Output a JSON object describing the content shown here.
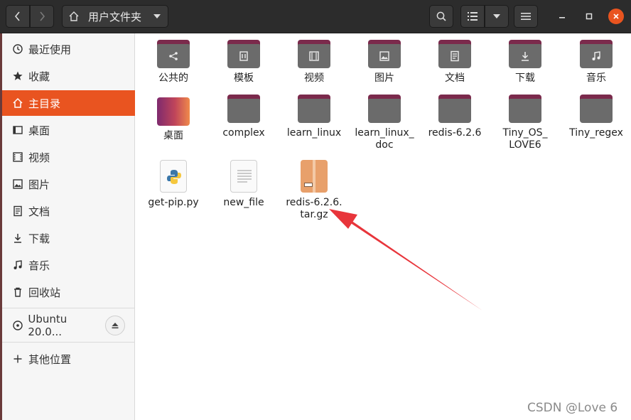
{
  "header": {
    "path_label": "用户文件夹",
    "icons": [
      "chevron-left-icon",
      "chevron-right-icon",
      "home-icon",
      "search-icon",
      "list-view-icon",
      "chevron-down-icon",
      "hamburger-menu-icon",
      "minimize-icon",
      "maximize-icon",
      "close-icon"
    ]
  },
  "sidebar": {
    "items": [
      {
        "label": "最近使用",
        "icon": "clock-icon"
      },
      {
        "label": "收藏",
        "icon": "star-icon"
      },
      {
        "label": "主目录",
        "icon": "home-icon",
        "active": true
      },
      {
        "label": "桌面",
        "icon": "desktop-icon"
      },
      {
        "label": "视频",
        "icon": "video-icon"
      },
      {
        "label": "图片",
        "icon": "image-icon"
      },
      {
        "label": "文档",
        "icon": "document-icon"
      },
      {
        "label": "下载",
        "icon": "download-icon"
      },
      {
        "label": "音乐",
        "icon": "music-icon"
      },
      {
        "label": "回收站",
        "icon": "trash-icon"
      }
    ],
    "drive": {
      "label": "Ubuntu 20.0...",
      "icon": "disc-icon"
    },
    "other": {
      "label": "其他位置",
      "icon": "plus-icon"
    }
  },
  "files": [
    {
      "name": "公共的",
      "kind": "folder",
      "icon": "share-icon"
    },
    {
      "name": "模板",
      "kind": "folder",
      "icon": "template-icon"
    },
    {
      "name": "视频",
      "kind": "folder",
      "icon": "video-icon"
    },
    {
      "name": "图片",
      "kind": "folder",
      "icon": "image-icon"
    },
    {
      "name": "文档",
      "kind": "folder",
      "icon": "document-icon"
    },
    {
      "name": "下载",
      "kind": "folder",
      "icon": "download-icon"
    },
    {
      "name": "音乐",
      "kind": "folder",
      "icon": "music-icon"
    },
    {
      "name": "桌面",
      "kind": "desktop-folder"
    },
    {
      "name": "complex",
      "kind": "folder"
    },
    {
      "name": "learn_linux",
      "kind": "folder"
    },
    {
      "name": "learn_linux_\ndoc",
      "kind": "folder"
    },
    {
      "name": "redis-6.2.6",
      "kind": "folder"
    },
    {
      "name": "Tiny_OS_\nLOVE6",
      "kind": "folder"
    },
    {
      "name": "Tiny_regex",
      "kind": "folder"
    },
    {
      "name": "get-pip.py",
      "kind": "python-file"
    },
    {
      "name": "new_file",
      "kind": "text-file"
    },
    {
      "name": "redis-6.2.6.\ntar.gz",
      "kind": "archive"
    }
  ],
  "watermark": "CSDN @Love 6",
  "colors": {
    "accent": "#e95420",
    "folder_tab": "#7b2a4c",
    "folder_body": "#6b6b6b",
    "header": "#2c2c2c",
    "arrow": "#e8353b"
  }
}
